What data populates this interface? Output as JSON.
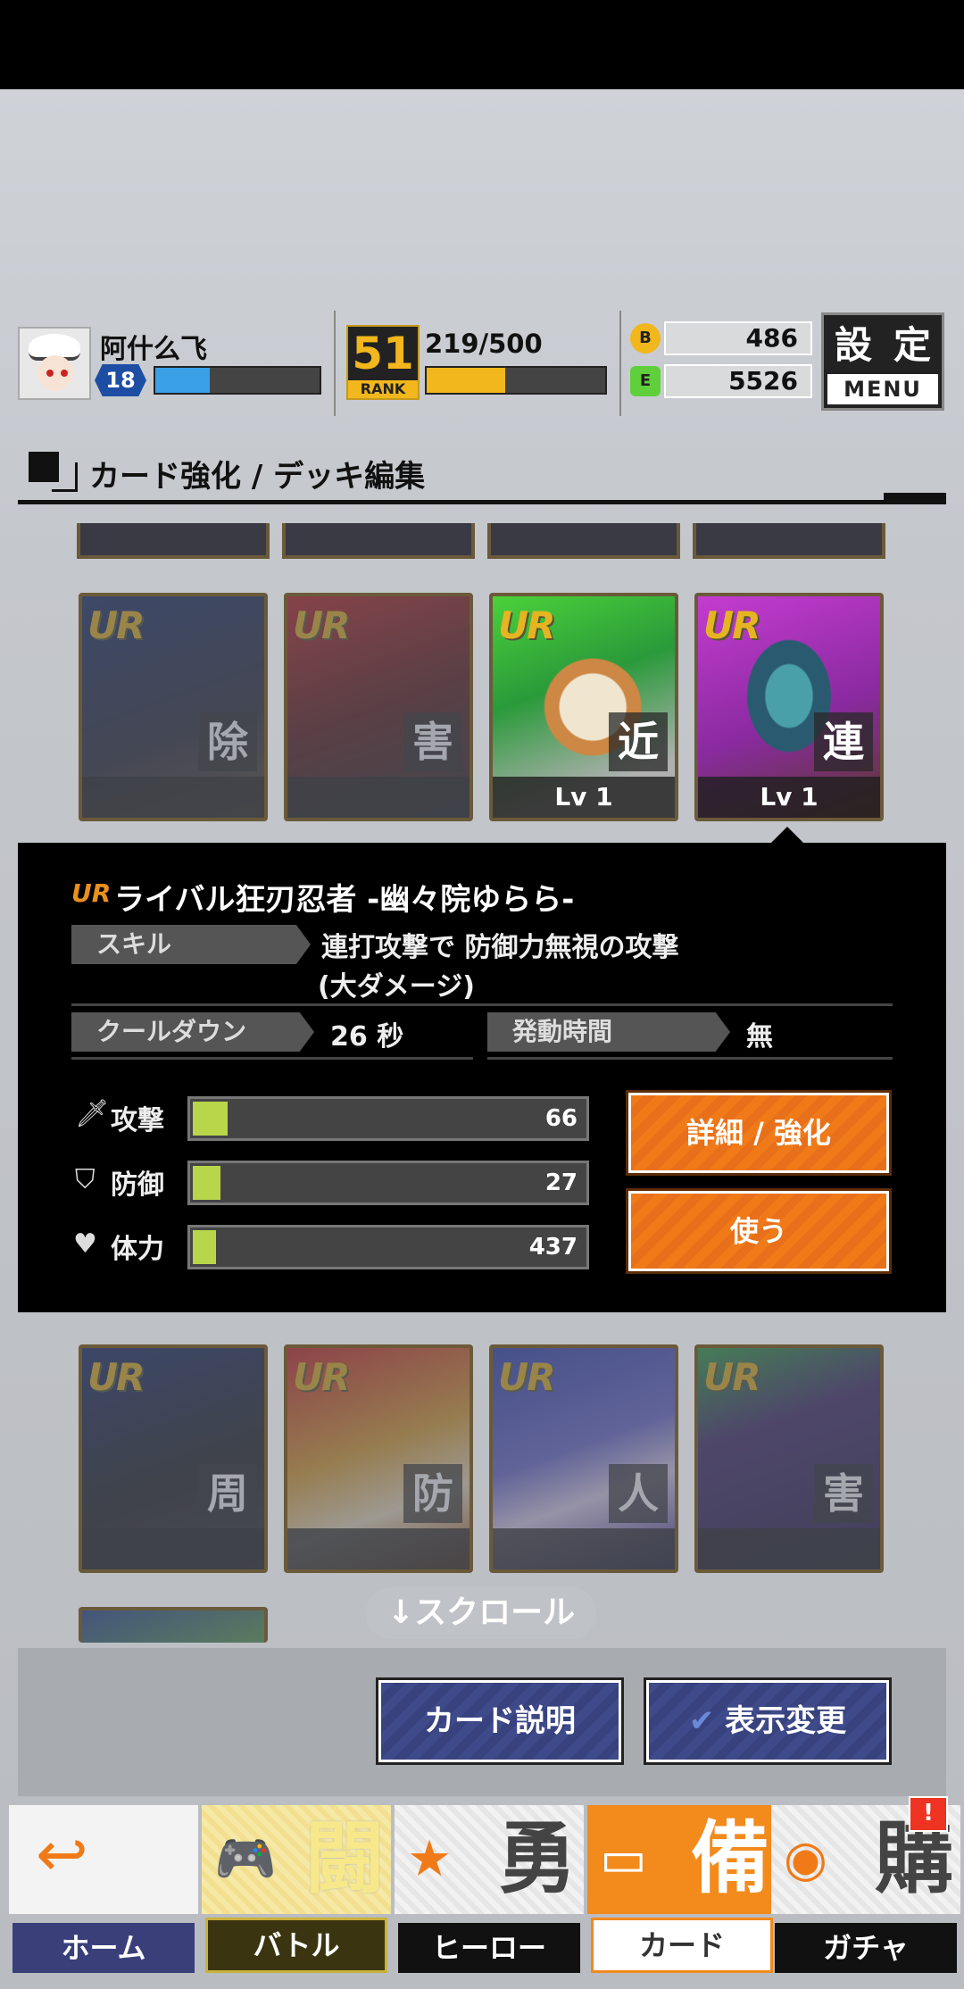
{
  "header": {
    "username": "阿什么飞",
    "level": "18",
    "rank": "51",
    "rank_label": "RANK",
    "exp": "219/500",
    "coins_icon": "B",
    "coins": "486",
    "gems_icon": "E",
    "gems": "5526",
    "menu_kanji_1": "設",
    "menu_kanji_2": "定",
    "menu_label": "MENU"
  },
  "section": {
    "title": "カード強化 / デッキ編集"
  },
  "cards_row1": [
    {
      "rarity": "UR",
      "attr": "除",
      "level": ""
    },
    {
      "rarity": "UR",
      "attr": "害",
      "level": ""
    },
    {
      "rarity": "UR",
      "attr": "近",
      "level": "Lv 1"
    },
    {
      "rarity": "UR",
      "attr": "連",
      "level": "Lv 1"
    }
  ],
  "detail": {
    "rarity": "UR",
    "name": "ライバル狂刃忍者 -幽々院ゆらら-",
    "skill_label": "スキル",
    "skill_text_1": "連打攻撃で 防御力無視の攻撃",
    "skill_text_2": "(大ダメージ)",
    "cooldown_label": "クールダウン",
    "cooldown_value": "26 秒",
    "duration_label": "発動時間",
    "duration_value": "無",
    "stats": [
      {
        "label": "攻撃",
        "value": "66",
        "fraction": 0.09
      },
      {
        "label": "防御",
        "value": "27",
        "fraction": 0.07
      },
      {
        "label": "体力",
        "value": "437",
        "fraction": 0.06
      }
    ],
    "detail_button": "詳細 / 強化",
    "use_button": "使う"
  },
  "cards_row2": [
    {
      "rarity": "UR",
      "attr": "周"
    },
    {
      "rarity": "UR",
      "attr": "防"
    },
    {
      "rarity": "UR",
      "attr": "人"
    },
    {
      "rarity": "UR",
      "attr": "害"
    }
  ],
  "scroll_hint": "↓スクロール",
  "buttons": {
    "card_desc": "カード説明",
    "display_change": "表示変更"
  },
  "tabs": [
    {
      "label": "ホーム",
      "kanji": "",
      "icon": "↩"
    },
    {
      "label": "バトル",
      "kanji": "闘",
      "icon": "🎮"
    },
    {
      "label": "ヒーロー",
      "kanji": "勇",
      "icon": "★"
    },
    {
      "label": "カード",
      "kanji": "備",
      "icon": "▭"
    },
    {
      "label": "ガチャ",
      "kanji": "購",
      "icon": "◉"
    }
  ],
  "gacha_badge": "!",
  "colors": {
    "accent_orange": "#f07a17",
    "exp_yellow": "#f2b71c",
    "level_blue": "#3aa0e8",
    "stat_green": "#b9d64a"
  }
}
